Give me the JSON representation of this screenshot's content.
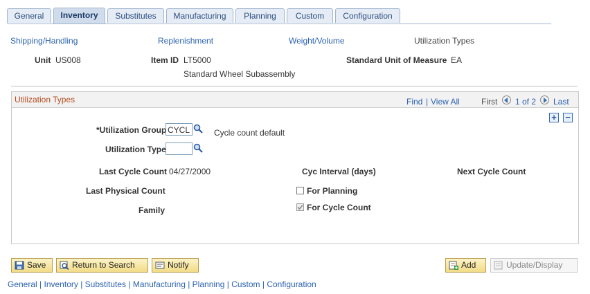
{
  "tabs": [
    {
      "label": "General",
      "active": false
    },
    {
      "label": "Inventory",
      "active": true
    },
    {
      "label": "Substitutes",
      "active": false
    },
    {
      "label": "Manufacturing",
      "active": false
    },
    {
      "label": "Planning",
      "active": false
    },
    {
      "label": "Custom",
      "active": false
    },
    {
      "label": "Configuration",
      "active": false
    }
  ],
  "subnav": {
    "shipping": "Shipping/Handling",
    "replenishment": "Replenishment",
    "weight": "Weight/Volume",
    "utilization": "Utilization Types"
  },
  "header": {
    "unit_label": "Unit",
    "unit_value": "US008",
    "item_label": "Item ID",
    "item_value": "LT5000",
    "item_desc": "Standard Wheel Subassembly",
    "uom_label": "Standard Unit of Measure",
    "uom_value": "EA"
  },
  "section": {
    "title": "Utilization Types",
    "find": "Find",
    "view_all": "View All",
    "first": "First",
    "page": "1 of 2",
    "last": "Last"
  },
  "fields": {
    "util_group_label": "*Utilization Group",
    "util_group_value": "CYCL",
    "util_group_desc": "Cycle count default",
    "util_type_label": "Utilization Type",
    "util_type_value": "",
    "last_cycle_label": "Last Cycle Count",
    "last_cycle_value": "04/27/2000",
    "cyc_interval_label": "Cyc Interval (days)",
    "next_cycle_label": "Next Cycle Count",
    "last_physical_label": "Last Physical Count",
    "for_planning_label": "For Planning",
    "family_label": "Family",
    "for_cycle_label": "For Cycle Count",
    "for_planning_checked": false,
    "for_cycle_checked": true
  },
  "toolbar": {
    "save": "Save",
    "return": "Return to Search",
    "notify": "Notify",
    "add": "Add",
    "update": "Update/Display"
  },
  "footer_links": [
    "General",
    "Inventory",
    "Substitutes",
    "Manufacturing",
    "Planning",
    "Custom",
    "Configuration"
  ],
  "colors": {
    "link": "#2d63b0",
    "section_title": "#b44b1c",
    "tab_bg": "#e5ecf5",
    "button_bg": "#f1dc87"
  }
}
